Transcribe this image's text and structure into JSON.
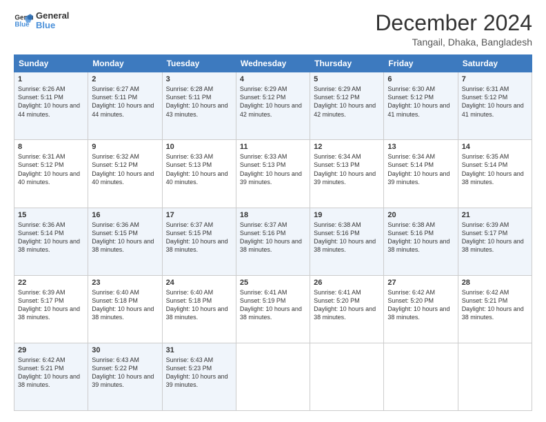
{
  "header": {
    "logo": {
      "line1": "General",
      "line2": "Blue"
    },
    "title": "December 2024",
    "subtitle": "Tangail, Dhaka, Bangladesh"
  },
  "days_of_week": [
    "Sunday",
    "Monday",
    "Tuesday",
    "Wednesday",
    "Thursday",
    "Friday",
    "Saturday"
  ],
  "weeks": [
    [
      {
        "day": "1",
        "sunrise": "6:26 AM",
        "sunset": "5:11 PM",
        "daylight": "10 hours and 44 minutes."
      },
      {
        "day": "2",
        "sunrise": "6:27 AM",
        "sunset": "5:11 PM",
        "daylight": "10 hours and 44 minutes."
      },
      {
        "day": "3",
        "sunrise": "6:28 AM",
        "sunset": "5:11 PM",
        "daylight": "10 hours and 43 minutes."
      },
      {
        "day": "4",
        "sunrise": "6:29 AM",
        "sunset": "5:12 PM",
        "daylight": "10 hours and 42 minutes."
      },
      {
        "day": "5",
        "sunrise": "6:29 AM",
        "sunset": "5:12 PM",
        "daylight": "10 hours and 42 minutes."
      },
      {
        "day": "6",
        "sunrise": "6:30 AM",
        "sunset": "5:12 PM",
        "daylight": "10 hours and 41 minutes."
      },
      {
        "day": "7",
        "sunrise": "6:31 AM",
        "sunset": "5:12 PM",
        "daylight": "10 hours and 41 minutes."
      }
    ],
    [
      {
        "day": "8",
        "sunrise": "6:31 AM",
        "sunset": "5:12 PM",
        "daylight": "10 hours and 40 minutes."
      },
      {
        "day": "9",
        "sunrise": "6:32 AM",
        "sunset": "5:12 PM",
        "daylight": "10 hours and 40 minutes."
      },
      {
        "day": "10",
        "sunrise": "6:33 AM",
        "sunset": "5:13 PM",
        "daylight": "10 hours and 40 minutes."
      },
      {
        "day": "11",
        "sunrise": "6:33 AM",
        "sunset": "5:13 PM",
        "daylight": "10 hours and 39 minutes."
      },
      {
        "day": "12",
        "sunrise": "6:34 AM",
        "sunset": "5:13 PM",
        "daylight": "10 hours and 39 minutes."
      },
      {
        "day": "13",
        "sunrise": "6:34 AM",
        "sunset": "5:14 PM",
        "daylight": "10 hours and 39 minutes."
      },
      {
        "day": "14",
        "sunrise": "6:35 AM",
        "sunset": "5:14 PM",
        "daylight": "10 hours and 38 minutes."
      }
    ],
    [
      {
        "day": "15",
        "sunrise": "6:36 AM",
        "sunset": "5:14 PM",
        "daylight": "10 hours and 38 minutes."
      },
      {
        "day": "16",
        "sunrise": "6:36 AM",
        "sunset": "5:15 PM",
        "daylight": "10 hours and 38 minutes."
      },
      {
        "day": "17",
        "sunrise": "6:37 AM",
        "sunset": "5:15 PM",
        "daylight": "10 hours and 38 minutes."
      },
      {
        "day": "18",
        "sunrise": "6:37 AM",
        "sunset": "5:16 PM",
        "daylight": "10 hours and 38 minutes."
      },
      {
        "day": "19",
        "sunrise": "6:38 AM",
        "sunset": "5:16 PM",
        "daylight": "10 hours and 38 minutes."
      },
      {
        "day": "20",
        "sunrise": "6:38 AM",
        "sunset": "5:16 PM",
        "daylight": "10 hours and 38 minutes."
      },
      {
        "day": "21",
        "sunrise": "6:39 AM",
        "sunset": "5:17 PM",
        "daylight": "10 hours and 38 minutes."
      }
    ],
    [
      {
        "day": "22",
        "sunrise": "6:39 AM",
        "sunset": "5:17 PM",
        "daylight": "10 hours and 38 minutes."
      },
      {
        "day": "23",
        "sunrise": "6:40 AM",
        "sunset": "5:18 PM",
        "daylight": "10 hours and 38 minutes."
      },
      {
        "day": "24",
        "sunrise": "6:40 AM",
        "sunset": "5:18 PM",
        "daylight": "10 hours and 38 minutes."
      },
      {
        "day": "25",
        "sunrise": "6:41 AM",
        "sunset": "5:19 PM",
        "daylight": "10 hours and 38 minutes."
      },
      {
        "day": "26",
        "sunrise": "6:41 AM",
        "sunset": "5:20 PM",
        "daylight": "10 hours and 38 minutes."
      },
      {
        "day": "27",
        "sunrise": "6:42 AM",
        "sunset": "5:20 PM",
        "daylight": "10 hours and 38 minutes."
      },
      {
        "day": "28",
        "sunrise": "6:42 AM",
        "sunset": "5:21 PM",
        "daylight": "10 hours and 38 minutes."
      }
    ],
    [
      {
        "day": "29",
        "sunrise": "6:42 AM",
        "sunset": "5:21 PM",
        "daylight": "10 hours and 38 minutes."
      },
      {
        "day": "30",
        "sunrise": "6:43 AM",
        "sunset": "5:22 PM",
        "daylight": "10 hours and 39 minutes."
      },
      {
        "day": "31",
        "sunrise": "6:43 AM",
        "sunset": "5:23 PM",
        "daylight": "10 hours and 39 minutes."
      },
      null,
      null,
      null,
      null
    ]
  ],
  "labels": {
    "sunrise": "Sunrise:",
    "sunset": "Sunset:",
    "daylight": "Daylight:"
  }
}
